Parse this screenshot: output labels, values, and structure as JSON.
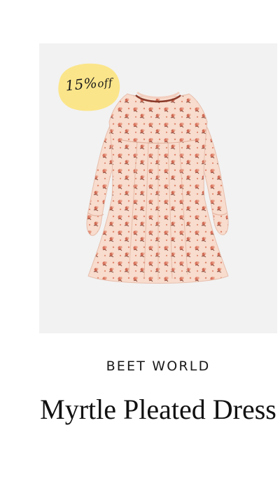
{
  "badge": {
    "percent": "15%",
    "suffix": "off",
    "color": "#fbe58a"
  },
  "product": {
    "brand": "BEET WORLD",
    "title": "Myrtle Pleated Dress",
    "image_icon": "floral-dress-image",
    "colors": {
      "panel": "#f2f2f2",
      "fabric": "#f7d6c6",
      "flower": "#d8745e",
      "leaf": "#8a4a3a"
    }
  }
}
